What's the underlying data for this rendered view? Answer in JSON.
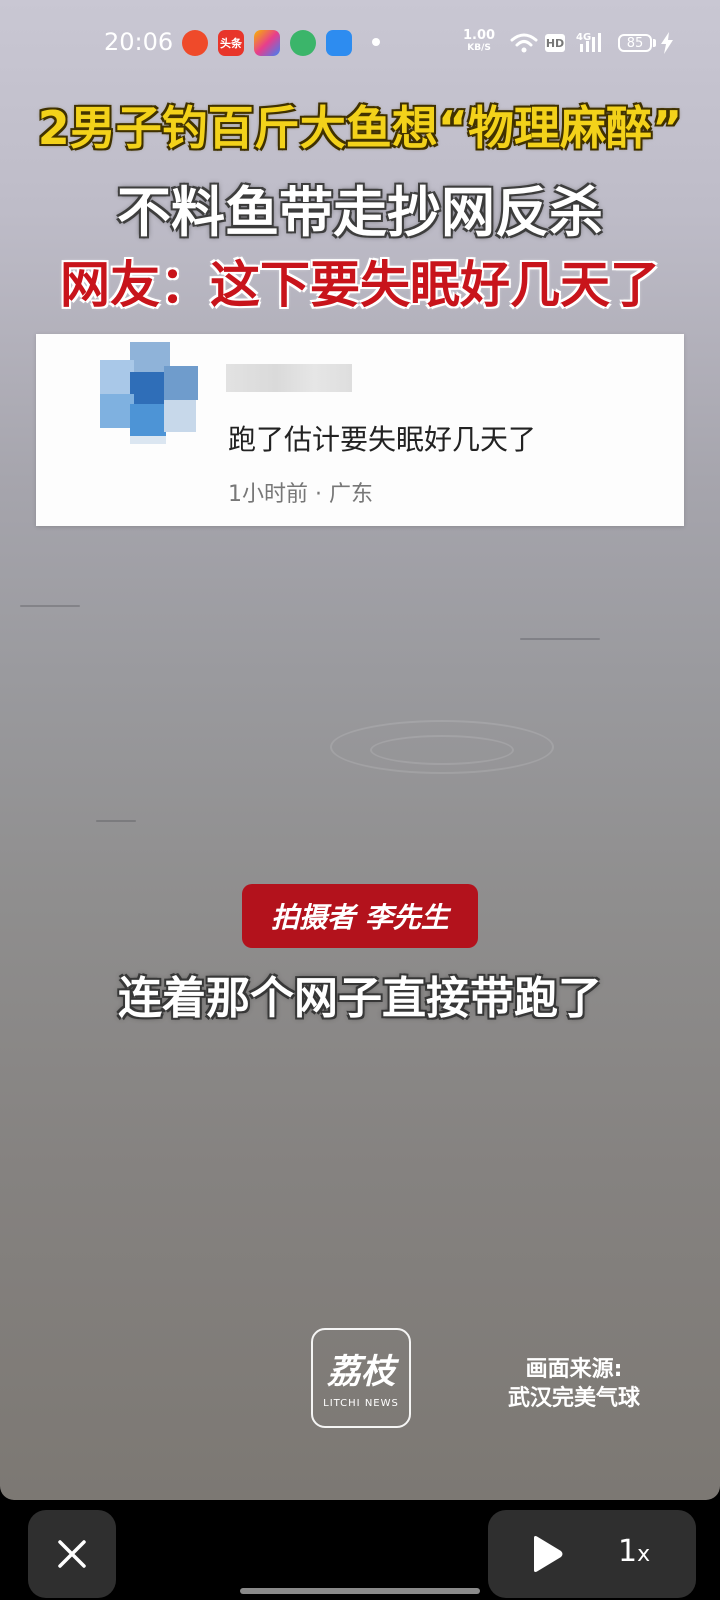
{
  "status_bar": {
    "time": "20:06",
    "net_speed_value": "1.00",
    "net_speed_unit": "KB/S",
    "hd_label": "HD",
    "network_label": "4G",
    "battery_level": "85",
    "app_icons": [
      {
        "name": "app-icon-1",
        "label": "",
        "color": "#ef4a2a"
      },
      {
        "name": "app-icon-toutiao",
        "label": "头条",
        "color": "#e8352a"
      },
      {
        "name": "app-icon-3",
        "label": "",
        "color": "#e83e8c"
      },
      {
        "name": "app-icon-4",
        "label": "",
        "color": "#3bb56a"
      },
      {
        "name": "app-icon-5",
        "label": "",
        "color": "#2d8cf0"
      }
    ]
  },
  "video": {
    "headline_1": "2男子钓百斤大鱼想“物理麻醉”",
    "headline_2": "不料鱼带走抄网反杀",
    "headline_3": "网友：这下要失眠好几天了",
    "comment": {
      "text": "跑了估计要失眠好几天了",
      "meta": "1小时前 · 广东"
    },
    "speaker_badge": "拍摄者 李先生",
    "caption": "连着那个网子直接带跑了",
    "logo_cn": "荔枝",
    "logo_en": "LITCHI NEWS",
    "source_line_1": "画面来源:",
    "source_line_2": "武汉完美气球"
  },
  "controls": {
    "close_icon": "close-icon",
    "play_icon": "play-icon",
    "speed": "1",
    "speed_suffix": "x"
  },
  "colors": {
    "headline_yellow": "#f3d21a",
    "headline_red": "#c8141b",
    "badge_red": "#b3121c",
    "control_bg": "#2f2f2f"
  }
}
